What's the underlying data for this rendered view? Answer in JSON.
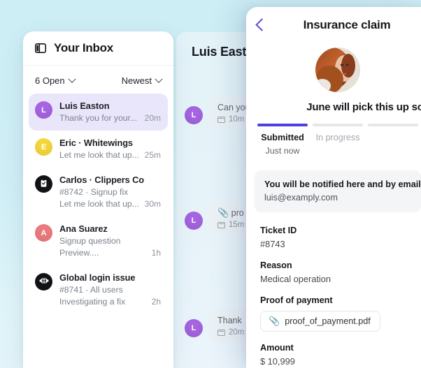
{
  "theme": {
    "background_start": "#cdeef5",
    "background_end": "#eef4fb",
    "accent_purple": "#4f3fe0",
    "avatar_purple": "#a765e3",
    "avatar_yellow": "#f5d73c",
    "avatar_red": "#ec7b80",
    "avatar_black": "#111216",
    "selected_row": "#e9e6fb"
  },
  "inbox": {
    "panel_toggle_icon": "sidebar-panel-icon",
    "title": "Your Inbox",
    "filters": {
      "status": {
        "label": "6 Open",
        "chevron_icon": "chevron-down-icon"
      },
      "sort": {
        "label": "Newest",
        "chevron_icon": "chevron-down-icon"
      }
    },
    "items": [
      {
        "avatar_letter": "L",
        "avatar_style": "purple",
        "avatar_icon": "",
        "name": "Luis Easton",
        "ticket": "",
        "preview": "Thank you for your...",
        "time": "20m",
        "selected": true
      },
      {
        "avatar_letter": "E",
        "avatar_style": "yellow",
        "avatar_icon": "",
        "name": "Eric · Whitewings",
        "ticket": "",
        "preview": "Let me look that up...",
        "time": "25m",
        "selected": false
      },
      {
        "avatar_letter": "",
        "avatar_style": "black",
        "avatar_icon": "clipboard-icon",
        "name": "Carlos · Clippers Co",
        "ticket": "#8742  ·  Signup fix",
        "preview": "Let me look that up...",
        "time": "30m",
        "selected": false
      },
      {
        "avatar_letter": "A",
        "avatar_style": "red",
        "avatar_icon": "",
        "name": "Ana Suarez",
        "ticket": "Signup question",
        "preview": "Preview....",
        "time": "1h",
        "selected": false
      },
      {
        "avatar_letter": "",
        "avatar_style": "black",
        "avatar_icon": "globe-network-icon",
        "name": "Global login issue",
        "ticket": "#8741 · All users",
        "preview": "Investigating a fix",
        "time": "2h",
        "selected": false
      }
    ]
  },
  "conversation": {
    "title": "Luis Easton",
    "messages": [
      {
        "avatar_letter": "L",
        "text": "Can you",
        "meta_icon": "message-note-icon",
        "time": "10m",
        "has_attachment": false
      },
      {
        "avatar_letter": "L",
        "text": "pro",
        "meta_icon": "message-note-icon",
        "time": "15m",
        "has_attachment": true,
        "attachment_icon": "paperclip-icon"
      },
      {
        "avatar_letter": "L",
        "text": "Thank",
        "meta_icon": "message-note-icon",
        "time": "20m",
        "has_attachment": false
      }
    ]
  },
  "detail": {
    "back_icon": "chevron-left-icon",
    "title": "Insurance claim",
    "avatar_name": "assignee-avatar",
    "assignment_text": "June will pick this up so",
    "stepper": [
      {
        "label": "Submitted",
        "time": "Just now",
        "active": true
      },
      {
        "label": "In progress",
        "time": "",
        "active": false
      },
      {
        "label": "",
        "time": "",
        "active": false
      }
    ],
    "notice": {
      "line1": "You will be notified here and by email",
      "line2": "luis@examply.com"
    },
    "fields": [
      {
        "label": "Ticket ID",
        "value": "#8743",
        "type": "text"
      },
      {
        "label": "Reason",
        "value": "Medical operation",
        "type": "text"
      },
      {
        "label": "Proof of payment",
        "value": "proof_of_payment.pdf",
        "type": "file",
        "file_icon": "paperclip-icon"
      },
      {
        "label": "Amount",
        "value": "$ 10,999",
        "type": "text"
      }
    ]
  }
}
